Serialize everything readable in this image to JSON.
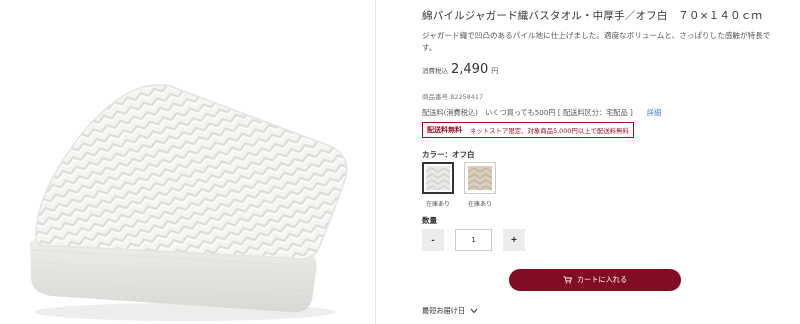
{
  "product": {
    "title": "綿パイルジャガード織バスタオル・中厚手／オフ白　７０×１４０ｃｍ",
    "description": "ジャガード織で凹凸のあるパイル地に仕上げました。適度なボリュームと、さっぱりした感触が特長です。",
    "price_label": "消費税込",
    "price_value": "2,490",
    "price_unit": "円",
    "product_no_label": "商品番号",
    "product_no": "82258417"
  },
  "shipping": {
    "text": "配送料(消費税込)　いくつ買っても500円 [ 配送料区分：宅配品 ]",
    "detail_link": "詳細",
    "free_badge": "配送料無料",
    "free_note": "ネットストア限定、対象商品5,000円以上で配送料無料"
  },
  "color": {
    "label": "カラー：オフ白",
    "options": [
      {
        "name": "オフ白",
        "stock": "在庫あり",
        "color": "#e8e8e6",
        "selected": true
      },
      {
        "name": "ベージュ",
        "stock": "在庫あり",
        "color": "#d6cdbd",
        "selected": false
      }
    ]
  },
  "quantity": {
    "label": "数量",
    "minus": "-",
    "value": "1",
    "plus": "+"
  },
  "cart": {
    "label": "カートに入れる"
  },
  "delivery": {
    "label": "最短お届け日"
  },
  "icons": {
    "cart": "cart-icon",
    "chevron": "chevron-down-icon"
  },
  "colors": {
    "accent": "#820d22",
    "link": "#3c7bd6"
  }
}
